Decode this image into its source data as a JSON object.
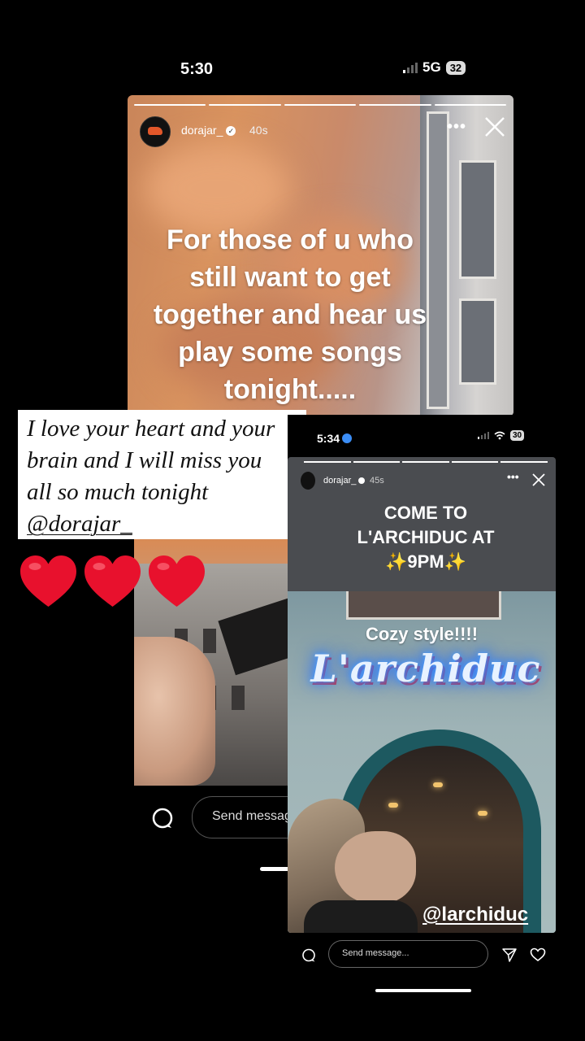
{
  "status_bar": {
    "time": "5:30",
    "network": "5G",
    "battery": "32"
  },
  "story1": {
    "username": "dorajar_",
    "time_ago": "40s",
    "text_lines": [
      "For those of u who",
      "still want to get",
      "together and hear us",
      "play some songs",
      "tonight....."
    ],
    "more_label": "•••",
    "reply_placeholder": "Send messag"
  },
  "note_overlay": {
    "lines": [
      "I love your heart and your",
      "brain and I will miss you",
      "all so much tonight"
    ],
    "mention": "@dorajar_"
  },
  "hearts": [
    "red-heart",
    "red-heart",
    "red-heart"
  ],
  "screenshot2": {
    "status_bar": {
      "time": "5:34",
      "battery": "30"
    },
    "story": {
      "username": "dorajar_",
      "time_ago": "45s",
      "more_label": "•••",
      "headline_lines": [
        "COME TO",
        "L'ARCHIDUC AT"
      ],
      "headline_time": "9PM",
      "sparkle": "✨",
      "sticker_text": "Cozy style!!!!",
      "neon_sign": "L'archiduc",
      "mention_sticker": "@larchiduc"
    },
    "reply_placeholder": "Send message..."
  },
  "colors": {
    "background": "#000000",
    "heart": "#e8112d",
    "neon": "#2a7bff"
  }
}
